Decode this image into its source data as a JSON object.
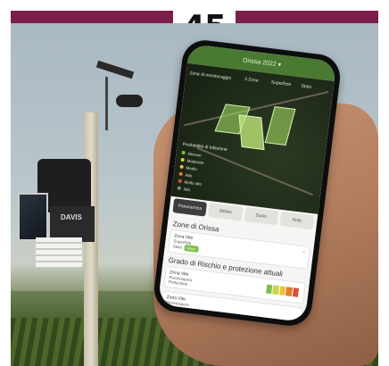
{
  "badge": {
    "number": "45"
  },
  "colors": {
    "topbar": "#7a1f4a",
    "app_green": "#4a7a32",
    "risk_low": "#7cbf4a",
    "risk_mid": "#f0c23a",
    "risk_high": "#d9503a"
  },
  "station": {
    "brand": "DAVIS"
  },
  "app": {
    "title": "Orissa 2022 ▾",
    "map": {
      "toggle": "Zone di monitoraggio",
      "stats": [
        {
          "value": "3",
          "label": "Zone"
        },
        {
          "value": "",
          "label": "Superficie"
        },
        {
          "value": "",
          "label": "Stato"
        }
      ],
      "legend_title": "Probabilità di infezione",
      "legend": [
        {
          "label": "Nessun",
          "color": "#7cbf4a"
        },
        {
          "label": "Moderato",
          "color": "#c6d94a"
        },
        {
          "label": "Medio",
          "color": "#f0c23a"
        },
        {
          "label": "Alto",
          "color": "#e57b2e"
        },
        {
          "label": "Molto alto",
          "color": "#d9503a"
        },
        {
          "label": "N/A",
          "color": "#888888"
        }
      ]
    },
    "tabs": [
      {
        "label": "Panoramica",
        "active": true
      },
      {
        "label": "Meteo",
        "active": false
      },
      {
        "label": "Suolo",
        "active": false
      },
      {
        "label": "Note",
        "active": false
      }
    ],
    "zones_heading": "Zone di Orissa",
    "zone_card": {
      "title": "Zona Vite",
      "line1": "Superficie",
      "line2": "Stato",
      "tag": "Attivo"
    },
    "risk_heading": "Grado di Rischio e protezione attuali",
    "risk_card": {
      "title": "Zona Vite",
      "line1": "Peronospora",
      "line2": "Protezione"
    },
    "zone_card2": {
      "title": "Zona Vite",
      "line1": "Peronospora"
    }
  }
}
